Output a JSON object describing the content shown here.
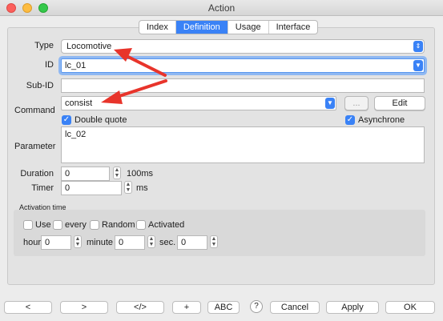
{
  "window": {
    "title": "Action"
  },
  "tabs": [
    "Index",
    "Definition",
    "Usage",
    "Interface"
  ],
  "form": {
    "type_label": "Type",
    "type_value": "Locomotive",
    "id_label": "ID",
    "id_value": "lc_01",
    "subid_label": "Sub-ID",
    "command_label": "Command",
    "command_value": "consist",
    "ellipsis_label": "...",
    "edit_label": "Edit",
    "double_quote_label": "Double quote",
    "asynchrone_label": "Asynchrone",
    "parameter_label": "Parameter",
    "parameter_value": "lc_02",
    "duration_label": "Duration",
    "duration_value": "0",
    "duration_unit": "100ms",
    "timer_label": "Timer",
    "timer_value": "0",
    "timer_unit": "ms"
  },
  "activation": {
    "title": "Activation time",
    "use_label": "Use",
    "every_label": "every",
    "random_label": "Random",
    "activated_label": "Activated",
    "hour_label": "hour",
    "hour_value": "0",
    "minute_label": "minute",
    "minute_value": "0",
    "sec_label": "sec.",
    "sec_value": "0"
  },
  "bottom": {
    "prev": "<",
    "next": ">",
    "code": "</>",
    "plus": "+",
    "abc": "ABC",
    "help": "?",
    "cancel": "Cancel",
    "apply": "Apply",
    "ok": "OK"
  },
  "colors": {
    "accent": "#3a82f6",
    "annotation_arrow": "#e8342b"
  }
}
